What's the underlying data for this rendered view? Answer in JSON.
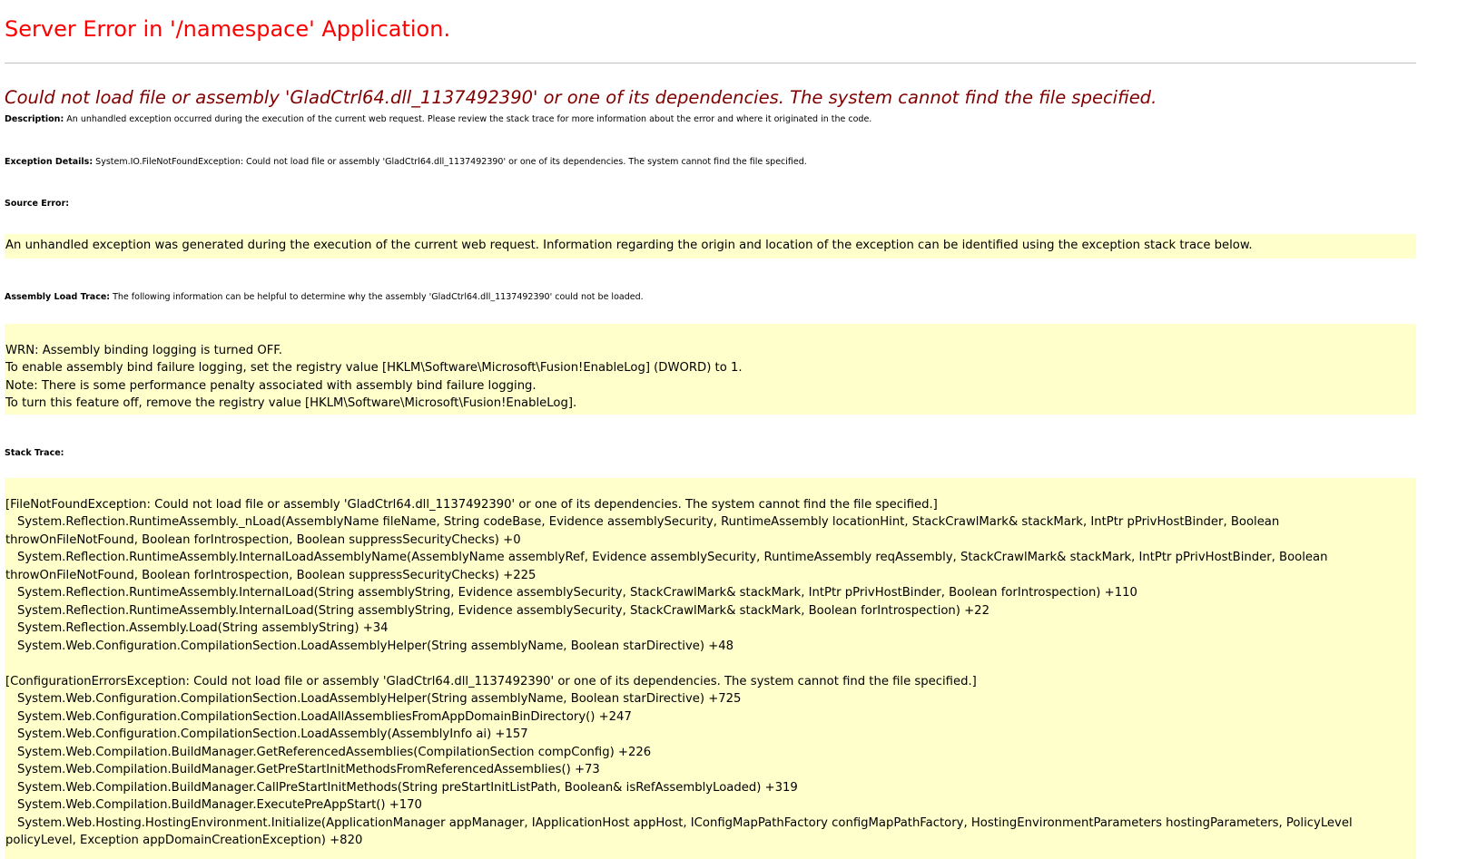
{
  "title": "Server Error in '/namespace' Application.",
  "error_message": "Could not load file or assembly 'GladCtrl64.dll_1137492390' or one of its dependencies. The system cannot find the file specified.",
  "description": {
    "label": "Description:",
    "text": "An unhandled exception occurred during the execution of the current web request. Please review the stack trace for more information about the error and where it originated in the code."
  },
  "exception_details": {
    "label": "Exception Details:",
    "text": "System.IO.FileNotFoundException: Could not load file or assembly 'GladCtrl64.dll_1137492390' or one of its dependencies. The system cannot find the file specified."
  },
  "source_error": {
    "label": "Source Error:",
    "text": "An unhandled exception was generated during the execution of the current web request. Information regarding the origin and location of the exception can be identified using the exception stack trace below."
  },
  "assembly_load_trace": {
    "label": "Assembly Load Trace:",
    "text": "The following information can be helpful to determine why the assembly 'GladCtrl64.dll_1137492390' could not be loaded.",
    "lines": [
      "WRN: Assembly binding logging is turned OFF.",
      "To enable assembly bind failure logging, set the registry value [HKLM\\Software\\Microsoft\\Fusion!EnableLog] (DWORD) to 1.",
      "Note: There is some performance penalty associated with assembly bind failure logging.",
      "To turn this feature off, remove the registry value [HKLM\\Software\\Microsoft\\Fusion!EnableLog]."
    ]
  },
  "stack_trace": {
    "label": "Stack Trace:",
    "block1": {
      "header": "[FileNotFoundException: Could not load file or assembly 'GladCtrl64.dll_1137492390' or one of its dependencies. The system cannot find the file specified.]",
      "frames": [
        "System.Reflection.RuntimeAssembly._nLoad(AssemblyName fileName, String codeBase, Evidence assemblySecurity, RuntimeAssembly locationHint, StackCrawlMark& stackMark, IntPtr pPrivHostBinder, Boolean throwOnFileNotFound, Boolean forIntrospection, Boolean suppressSecurityChecks) +0",
        "System.Reflection.RuntimeAssembly.InternalLoadAssemblyName(AssemblyName assemblyRef, Evidence assemblySecurity, RuntimeAssembly reqAssembly, StackCrawlMark& stackMark, IntPtr pPrivHostBinder, Boolean throwOnFileNotFound, Boolean forIntrospection, Boolean suppressSecurityChecks) +225",
        "System.Reflection.RuntimeAssembly.InternalLoad(String assemblyString, Evidence assemblySecurity, StackCrawlMark& stackMark, IntPtr pPrivHostBinder, Boolean forIntrospection) +110",
        "System.Reflection.RuntimeAssembly.InternalLoad(String assemblyString, Evidence assemblySecurity, StackCrawlMark& stackMark, Boolean forIntrospection) +22",
        "System.Reflection.Assembly.Load(String assemblyString) +34",
        "System.Web.Configuration.CompilationSection.LoadAssemblyHelper(String assemblyName, Boolean starDirective) +48"
      ]
    },
    "block2": {
      "header": "[ConfigurationErrorsException: Could not load file or assembly 'GladCtrl64.dll_1137492390' or one of its dependencies. The system cannot find the file specified.]",
      "frames": [
        "System.Web.Configuration.CompilationSection.LoadAssemblyHelper(String assemblyName, Boolean starDirective) +725",
        "System.Web.Configuration.CompilationSection.LoadAllAssembliesFromAppDomainBinDirectory() +247",
        "System.Web.Configuration.CompilationSection.LoadAssembly(AssemblyInfo ai) +157",
        "System.Web.Compilation.BuildManager.GetReferencedAssemblies(CompilationSection compConfig) +226",
        "System.Web.Compilation.BuildManager.GetPreStartInitMethodsFromReferencedAssemblies() +73",
        "System.Web.Compilation.BuildManager.CallPreStartInitMethods(String preStartInitListPath, Boolean& isRefAssemblyLoaded) +319",
        "System.Web.Compilation.BuildManager.ExecutePreAppStart() +170",
        "System.Web.Hosting.HostingEnvironment.Initialize(ApplicationManager appManager, IApplicationHost appHost, IConfigMapPathFactory configMapPathFactory, HostingEnvironmentParameters hostingParameters, PolicyLevel policyLevel, Exception appDomainCreationException) +820"
      ]
    }
  }
}
